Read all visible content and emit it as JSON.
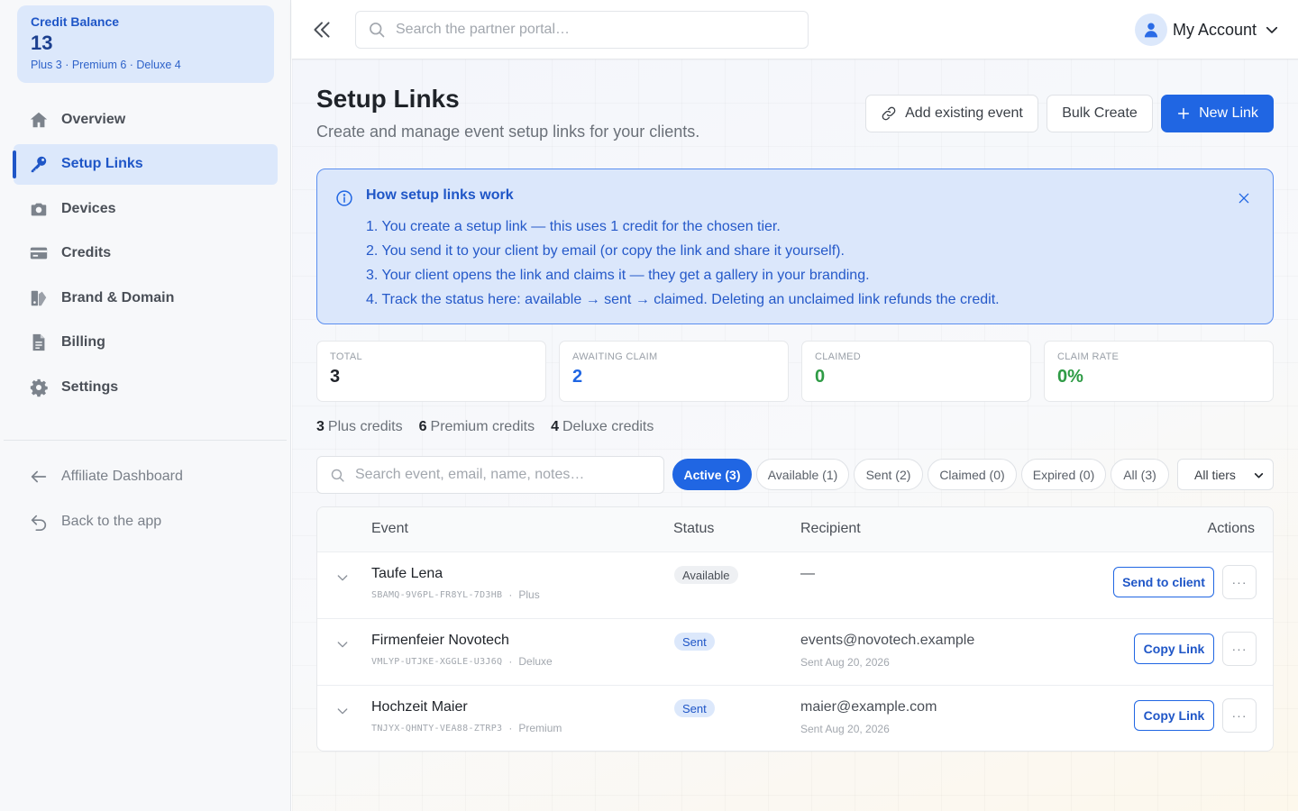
{
  "credit_balance": {
    "label": "Credit Balance",
    "value": "13",
    "breakdown": "Plus 3 · Premium 6 · Deluxe 4"
  },
  "sidebar": {
    "items": [
      {
        "label": "Overview",
        "icon": "home-icon"
      },
      {
        "label": "Setup Links",
        "icon": "key-icon",
        "active": true
      },
      {
        "label": "Devices",
        "icon": "camera-icon"
      },
      {
        "label": "Credits",
        "icon": "credit-card-icon"
      },
      {
        "label": "Brand & Domain",
        "icon": "brand-icon"
      },
      {
        "label": "Billing",
        "icon": "file-invoice-icon"
      },
      {
        "label": "Settings",
        "icon": "gear-icon"
      }
    ],
    "secondary": [
      {
        "label": "Affiliate Dashboard",
        "icon": "arrow-left-icon"
      },
      {
        "label": "Back to the app",
        "icon": "undo-icon"
      }
    ]
  },
  "topbar": {
    "search_placeholder": "Search the partner portal…",
    "account_label": "My Account"
  },
  "page": {
    "title": "Setup Links",
    "subtitle": "Create and manage event setup links for your clients.",
    "buttons": {
      "add_existing": "Add existing event",
      "bulk_create": "Bulk Create",
      "new_link": "New Link"
    }
  },
  "info": {
    "title": "How setup links work",
    "steps": [
      "1. You create a setup link — this uses 1 credit for the chosen tier.",
      "2. You send it to your client by email (or copy the link and share it yourself).",
      "3. Your client opens the link and claims it — they get a gallery in your branding.",
      "4. Track the status here: available → sent → claimed. Deleting an unclaimed link refunds the credit."
    ]
  },
  "stats": [
    {
      "label": "TOTAL",
      "value": "3",
      "color": "#1f2329"
    },
    {
      "label": "AWAITING CLAIM",
      "value": "2",
      "color": "#2066e3"
    },
    {
      "label": "CLAIMED",
      "value": "0",
      "color": "#2e9b45"
    },
    {
      "label": "CLAIM RATE",
      "value": "0%",
      "color": "#2e9b45"
    }
  ],
  "credits_summary": [
    {
      "count": "3",
      "label": "Plus credits"
    },
    {
      "count": "6",
      "label": "Premium credits"
    },
    {
      "count": "4",
      "label": "Deluxe credits"
    }
  ],
  "filters": {
    "search_placeholder": "Search event, email, name, notes…",
    "chips": [
      {
        "label": "Active (3)",
        "active": true
      },
      {
        "label": "Available (1)"
      },
      {
        "label": "Sent (2)"
      },
      {
        "label": "Claimed (0)"
      },
      {
        "label": "Expired (0)"
      },
      {
        "label": "All (3)"
      }
    ],
    "tier_select": "All tiers"
  },
  "table": {
    "headers": {
      "event": "Event",
      "status": "Status",
      "recipient": "Recipient",
      "actions": "Actions"
    },
    "rows": [
      {
        "name": "Taufe Lena",
        "code": "SBAMQ-9V6PL-FR8YL-7D3HB",
        "tier": "Plus",
        "status": "Available",
        "status_type": "available",
        "recipient": "—",
        "recipient_sub": "",
        "action": "Send to client",
        "more": "···"
      },
      {
        "name": "Firmenfeier Novotech",
        "code": "VMLYP-UTJKE-XGGLE-U3J6Q",
        "tier": "Deluxe",
        "status": "Sent",
        "status_type": "sent",
        "recipient": "events@novotech.example",
        "recipient_sub": "Sent Aug 20, 2026",
        "action": "Copy Link",
        "more": "···"
      },
      {
        "name": "Hochzeit Maier",
        "code": "TNJYX-QHNTY-VEA88-ZTRP3",
        "tier": "Premium",
        "status": "Sent",
        "status_type": "sent",
        "recipient": "maier@example.com",
        "recipient_sub": "Sent Aug 20, 2026",
        "action": "Copy Link",
        "more": "···"
      }
    ]
  },
  "colors": {
    "accent": "#2066e3",
    "accent_light": "#dce8fb",
    "success": "#2e9b45"
  }
}
